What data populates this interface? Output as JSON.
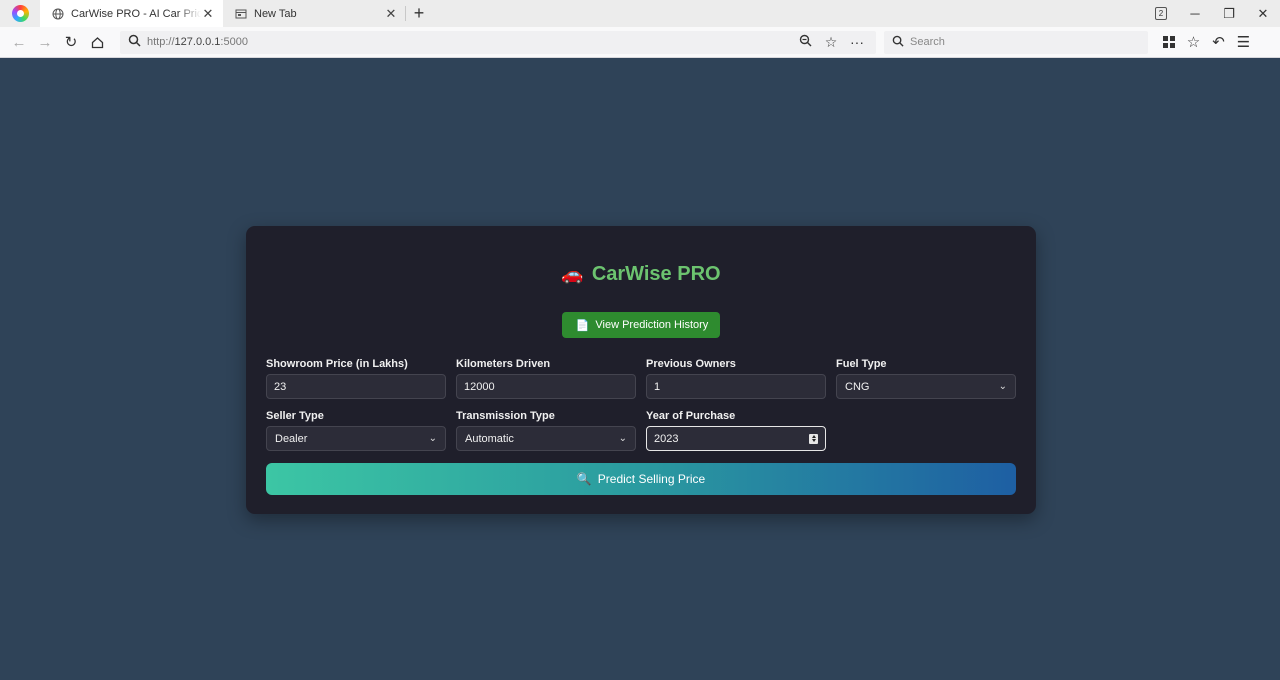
{
  "browser": {
    "tabs": [
      {
        "title": "CarWise PRO - AI Car Price Predictor",
        "icon": "globe-icon",
        "active": true
      },
      {
        "title": "New Tab",
        "icon": "newtab-icon",
        "active": false
      }
    ],
    "new_tab_label": "+",
    "tab_count": "2",
    "url_scheme_prefix": "http://",
    "url_host": "127.0.0.1",
    "url_port": ":5000",
    "search_placeholder": "Search"
  },
  "app": {
    "title_emoji": "🚗",
    "title": "CarWise PRO",
    "history_button_icon": "📄",
    "history_button_label": "View Prediction History",
    "fields": {
      "showroom_price": {
        "label": "Showroom Price (in Lakhs)",
        "value": "23"
      },
      "kms_driven": {
        "label": "Kilometers Driven",
        "value": "12000"
      },
      "previous_owners": {
        "label": "Previous Owners",
        "value": "1"
      },
      "fuel_type": {
        "label": "Fuel Type",
        "value": "CNG"
      },
      "seller_type": {
        "label": "Seller Type",
        "value": "Dealer"
      },
      "transmission_type": {
        "label": "Transmission Type",
        "value": "Automatic"
      },
      "year_of_purchase": {
        "label": "Year of Purchase",
        "value": "2023"
      }
    },
    "predict_button_icon": "🔍",
    "predict_button_label": "Predict Selling Price"
  },
  "colors": {
    "page_bg": "#2f4358",
    "card_bg": "#1f1f2b",
    "title_green": "#6cc36f",
    "history_button_bg": "#2e8b2f",
    "predict_gradient_start": "#3cc6a4",
    "predict_gradient_end": "#1e5fa3"
  }
}
